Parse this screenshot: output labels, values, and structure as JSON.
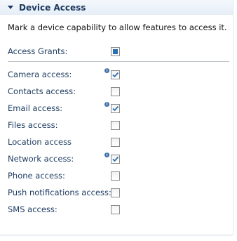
{
  "section": {
    "title": "Device Access",
    "description": "Mark a device capability to allow features to access it."
  },
  "access_grants": {
    "label": "Access Grants:",
    "state": "indeterminate"
  },
  "capabilities": [
    {
      "label": "Camera access:",
      "checked": true,
      "info": true
    },
    {
      "label": "Contacts access:",
      "checked": false,
      "info": false
    },
    {
      "label": "Email access:",
      "checked": true,
      "info": true
    },
    {
      "label": "Files access:",
      "checked": false,
      "info": false
    },
    {
      "label": "Location access",
      "checked": false,
      "info": false
    },
    {
      "label": "Network access:",
      "checked": true,
      "info": true
    },
    {
      "label": "Phone access:",
      "checked": false,
      "info": false
    },
    {
      "label": "Push notifications access:",
      "checked": false,
      "info": false
    },
    {
      "label": "SMS access:",
      "checked": false,
      "info": false
    }
  ],
  "colors": {
    "header_text": "#1b3a5f",
    "check_blue": "#2a6fae"
  }
}
